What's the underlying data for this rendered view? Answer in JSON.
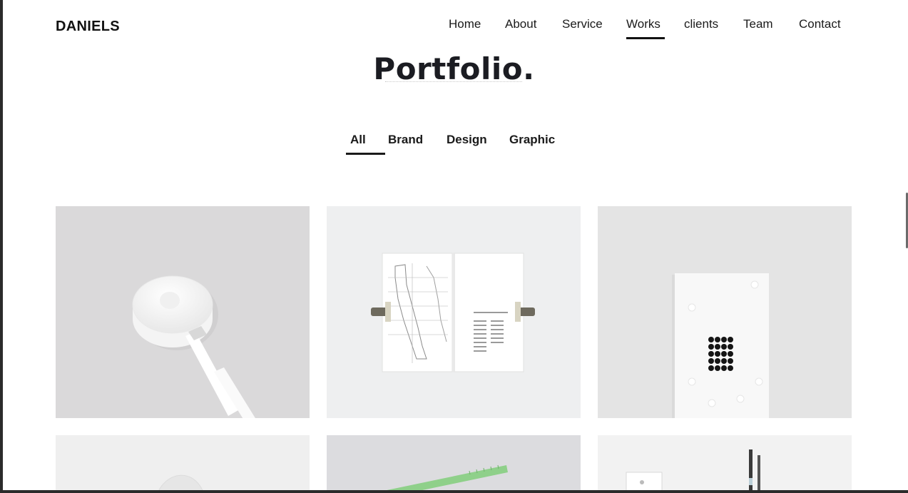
{
  "brand": {
    "name": "DANIELS"
  },
  "nav": {
    "items": [
      {
        "label": "Home"
      },
      {
        "label": "About"
      },
      {
        "label": "Service"
      },
      {
        "label": "Works",
        "active": true
      },
      {
        "label": "clients"
      },
      {
        "label": "Team"
      },
      {
        "label": "Contact"
      }
    ]
  },
  "portfolio": {
    "title": "Portfolio.",
    "filters": [
      {
        "label": "All",
        "active": true
      },
      {
        "label": "Brand"
      },
      {
        "label": "Design"
      },
      {
        "label": "Graphic"
      }
    ],
    "items": [
      {
        "icon": "charger-photo"
      },
      {
        "icon": "map-booklet-photo"
      },
      {
        "icon": "dot-card-photo"
      },
      {
        "icon": "glass-object-photo"
      },
      {
        "icon": "green-ruler-photo"
      },
      {
        "icon": "pens-stationery-photo"
      }
    ]
  },
  "colors": {
    "accent": "#111111",
    "background": "#ffffff",
    "text": "#1a1a1a"
  }
}
